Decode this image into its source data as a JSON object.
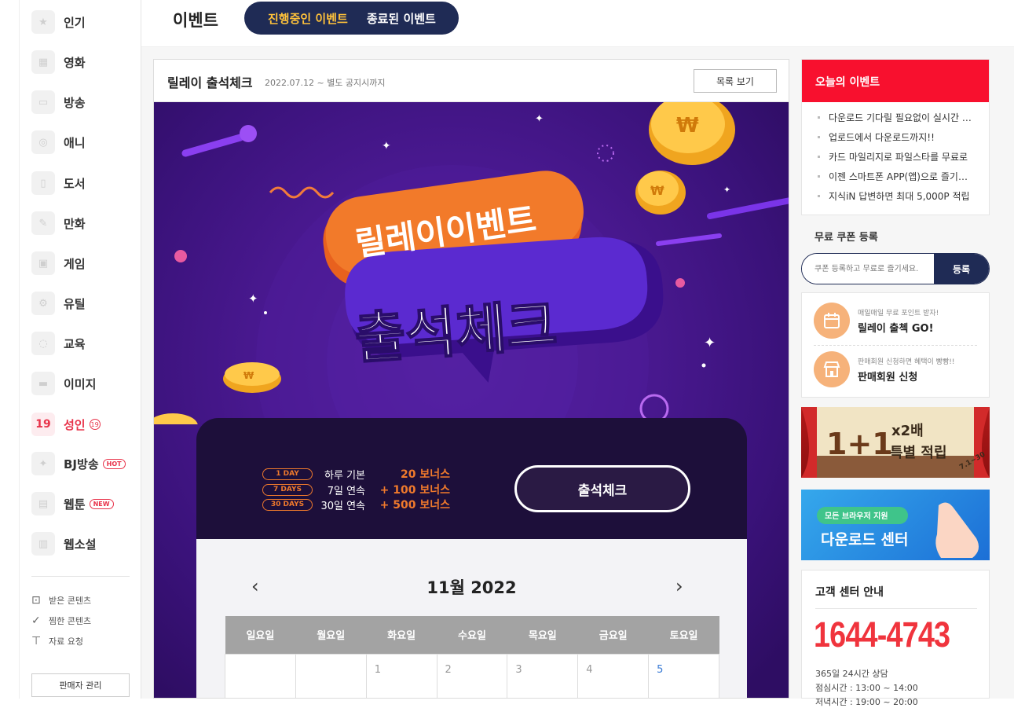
{
  "sidebar": {
    "items": [
      {
        "label": "인기",
        "icon": "star-icon"
      },
      {
        "label": "영화",
        "icon": "film-icon"
      },
      {
        "label": "방송",
        "icon": "tv-icon"
      },
      {
        "label": "애니",
        "icon": "animation-icon"
      },
      {
        "label": "도서",
        "icon": "book-icon"
      },
      {
        "label": "만화",
        "icon": "comic-icon"
      },
      {
        "label": "게임",
        "icon": "gamepad-icon"
      },
      {
        "label": "유틸",
        "icon": "gear-icon"
      },
      {
        "label": "교육",
        "icon": "lightbulb-icon"
      },
      {
        "label": "이미지",
        "icon": "truck-icon"
      },
      {
        "label": "성인",
        "icon_text": "19",
        "badge": "19"
      },
      {
        "label": "BJ방송",
        "icon": "sparkle-icon",
        "badge": "HOT"
      },
      {
        "label": "웹툰",
        "icon": "webtoon-icon",
        "badge": "NEW"
      },
      {
        "label": "웹소설",
        "icon": "document-icon"
      }
    ],
    "links": [
      {
        "label": "받은 콘텐츠",
        "icon": "download-box-icon"
      },
      {
        "label": "찜한 콘텐츠",
        "icon": "double-check-icon"
      },
      {
        "label": "자료 요청",
        "icon": "request-icon"
      }
    ],
    "seller_button": "판매자 관리"
  },
  "header": {
    "title": "이벤트",
    "tabs": [
      {
        "label": "진행중인 이벤트",
        "active": true
      },
      {
        "label": "종료된 이벤트",
        "active": false
      }
    ]
  },
  "event": {
    "title": "릴레이 출석체크",
    "date": "2022.07.12 ~ 별도 공지시까지",
    "list_button": "목록 보기",
    "banner": {
      "headline_top": "릴레이이벤트",
      "headline_main": "출석체크",
      "rewards": [
        {
          "pill": "1 DAY",
          "desc": "하루 기본",
          "bonus": "20 보너스"
        },
        {
          "pill": "7 DAYS",
          "desc": "7일 연속",
          "bonus": "+ 100 보너스"
        },
        {
          "pill": "30 DAYS",
          "desc": "30일 연속",
          "bonus": "+ 500 보너스"
        }
      ],
      "check_button": "출석체크"
    },
    "calendar": {
      "month": "11월 2022",
      "weekdays": [
        "일요일",
        "월요일",
        "화요일",
        "수요일",
        "목요일",
        "금요일",
        "토요일"
      ],
      "first_row": [
        "",
        "",
        "1",
        "2",
        "3",
        "4",
        "5"
      ]
    }
  },
  "right": {
    "today_events": {
      "title": "오늘의 이벤트",
      "items": [
        "다운로드 기다릴 필요없이 실시간 다운로드",
        "업로드에서 다운로드까지!!",
        "카드 마일리지로 파일스타를 무료로",
        "이젠 스마트폰 APP(앱)으로 즐기세요",
        "지식iN 답변하면 최대 5,000P 적립"
      ]
    },
    "coupon": {
      "title": "무료 쿠폰 등록",
      "placeholder": "쿠폰 등록하고 무료로 즐기세요.",
      "button": "등록"
    },
    "promos": [
      {
        "sub": "매일매일 무료 포인트 받자!",
        "main": "릴레이 출첵 GO!",
        "icon": "calendar-icon"
      },
      {
        "sub": "판매회원 신청하면 혜택이 빵빵!!",
        "main": "판매회원 신청",
        "icon": "store-icon"
      }
    ],
    "ad1": {
      "big": "1+1",
      "mult": "x2배",
      "sub": "특별 적립",
      "date": "7.1~30"
    },
    "ad2": {
      "pill": "모든 브라우저 지원",
      "text": "다운로드 센터"
    },
    "cs": {
      "title": "고객 센터 안내",
      "phone": "1644-4743",
      "line1": "365일 24시간 상담",
      "line2": "점심시간 : 13:00 ~ 14:00",
      "line3": "저녁시간 : 19:00 ~ 20:00"
    }
  },
  "colors": {
    "navy": "#1f2b55",
    "tab_active": "#ffc23a",
    "red": "#f8102e",
    "adult": "#e8334a",
    "banner_purple": "#48188e",
    "orange": "#f07a2c"
  }
}
